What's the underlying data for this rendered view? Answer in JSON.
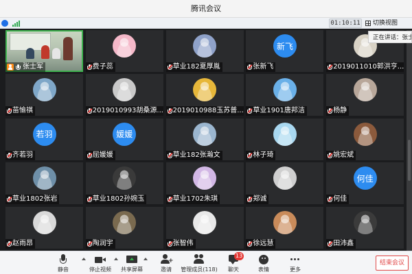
{
  "window": {
    "title": "腾讯会议"
  },
  "statusbar": {
    "timer": "01:10:11",
    "switch_view": "切换视图"
  },
  "speaking": {
    "text": "正在讲话：张士军"
  },
  "colors": {
    "accent": "#2d8cf0",
    "speaking_border": "#3fb34f",
    "end_red": "#e04848",
    "badge_red": "#e53935"
  },
  "participants": [
    {
      "name": "张士军",
      "avatar": "video",
      "host": true
    },
    {
      "name": "费子蕊",
      "avatar": "cartoon-icon",
      "bg": "#f5b8c9"
    },
    {
      "name": "草业182夏厚胤",
      "avatar": "photo-icon",
      "bg": "#8fa2c9"
    },
    {
      "name": "张新飞",
      "avatar": "text",
      "avatar_text": "新飞"
    },
    {
      "name": "2019011010郭洪亨...",
      "avatar": "photo-icon",
      "bg": "#d8d2c5"
    },
    {
      "name": "苗愉祺",
      "avatar": "photo-icon",
      "bg": "#7fa7c8"
    },
    {
      "name": "2019010993胡桑源...",
      "avatar": "photo-icon",
      "bg": "#c9c9c9"
    },
    {
      "name": "2019010988玉苏普...",
      "avatar": "photo-icon",
      "bg": "#e7b73a"
    },
    {
      "name": "草业1901唐邦洁",
      "avatar": "photo-icon",
      "bg": "#6ab0e8"
    },
    {
      "name": "杨静",
      "avatar": "photo-icon",
      "bg": "#b8a79a"
    },
    {
      "name": "齐若羽",
      "avatar": "text",
      "avatar_text": "若羽"
    },
    {
      "name": "屈媛媛",
      "avatar": "text",
      "avatar_text": "媛媛"
    },
    {
      "name": "草业182张瀚文",
      "avatar": "photo-icon",
      "bg": "#9bb6cf"
    },
    {
      "name": "林子琦",
      "avatar": "photo-icon",
      "bg": "#a9d8f0"
    },
    {
      "name": "姚宏斌",
      "avatar": "photo-icon",
      "bg": "#8b5a3c"
    },
    {
      "name": "草业1802张岩",
      "avatar": "photo-icon",
      "bg": "#6e8fa8"
    },
    {
      "name": "草业1802孙婉玉",
      "avatar": "photo-icon",
      "bg": "#3a3a3a"
    },
    {
      "name": "草业1702朱琪",
      "avatar": "photo-icon",
      "bg": "#d2b7e5"
    },
    {
      "name": "郑诚",
      "avatar": "photo-icon",
      "bg": "#cfcfcf"
    },
    {
      "name": "何佳",
      "avatar": "text",
      "avatar_text": "何佳"
    },
    {
      "name": "赵雨昂",
      "avatar": "photo-icon",
      "bg": "#d9d9d9"
    },
    {
      "name": "陶润宇",
      "avatar": "photo-icon",
      "bg": "#7a6a4f"
    },
    {
      "name": "张智伟",
      "avatar": "photo-icon",
      "bg": "#e8e8e8"
    },
    {
      "name": "徐远慧",
      "avatar": "photo-icon",
      "bg": "#c98b5a"
    },
    {
      "name": "田沛鑫",
      "avatar": "photo-icon",
      "bg": "#3b3b3b"
    }
  ],
  "toolbar": {
    "mute": "静音",
    "stop_video": "停止视频",
    "share_screen": "共享屏幕",
    "invite": "邀请",
    "manage_members": "管理成员(118)",
    "chat": "聊天",
    "chat_badge": "13",
    "reactions": "表情",
    "more": "更多",
    "end_meeting": "结束会议"
  }
}
